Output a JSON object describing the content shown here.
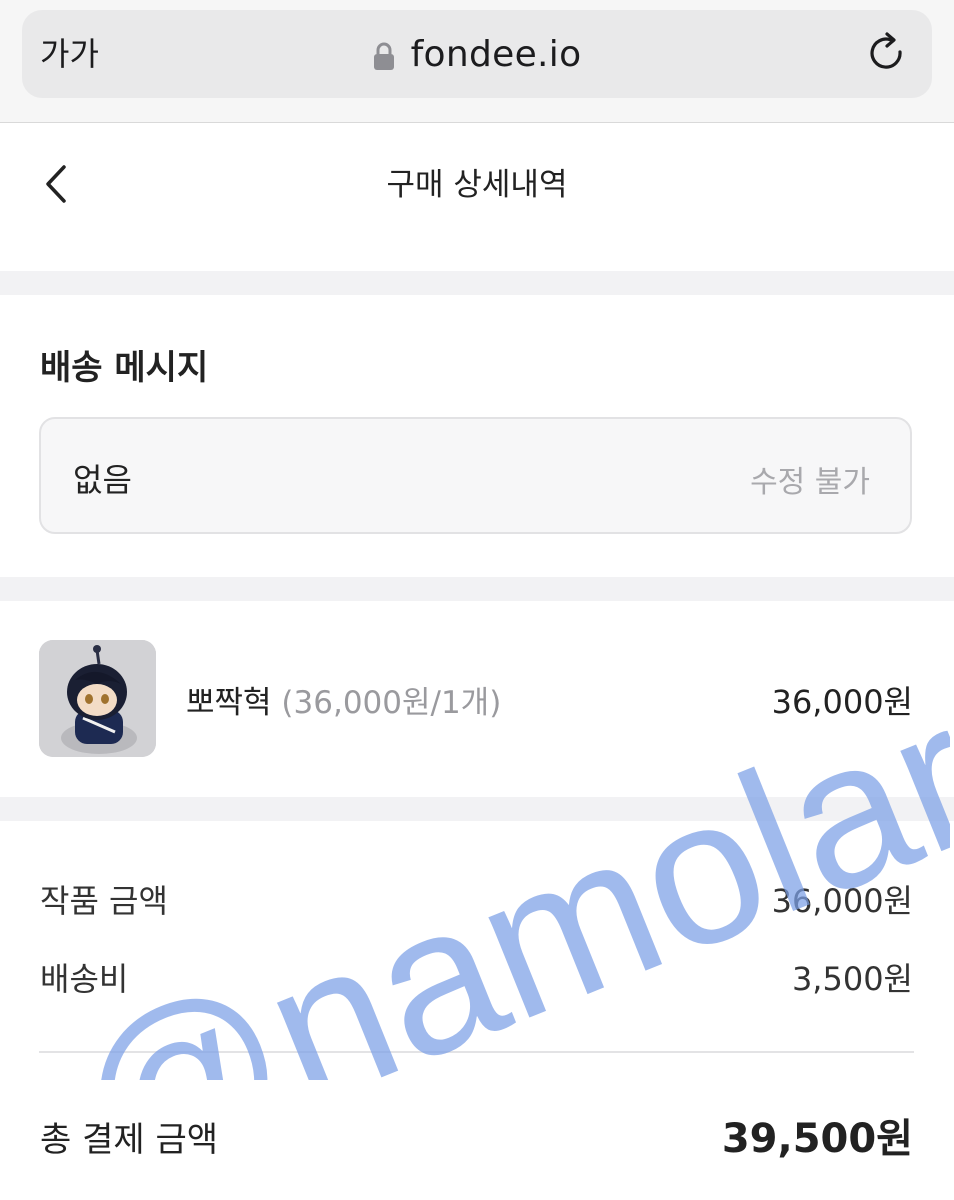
{
  "browser": {
    "text_size_label": "가가",
    "url": "fondee.io",
    "lock_icon": "lock-icon",
    "reload_icon": "reload-icon"
  },
  "header": {
    "title": "구매 상세내역",
    "back_icon": "chevron-left-icon"
  },
  "delivery_message": {
    "title": "배송 메시지",
    "value": "없음",
    "note": "수정 불가"
  },
  "product": {
    "name": "뽀짝혁",
    "unit_info": "(36,000원/1개)",
    "price": "36,000원"
  },
  "summary": {
    "items_label": "작품 금액",
    "items_value": "36,000원",
    "shipping_label": "배송비",
    "shipping_value": "3,500원",
    "total_label": "총 결제 금액",
    "total_value": "39,500원"
  },
  "watermark": {
    "text": "@namolar",
    "color": "#7b9fe6"
  },
  "colors": {
    "band": "#f2f2f4",
    "muted_text": "#a9a9ad",
    "box_bg": "#f7f7f8"
  }
}
